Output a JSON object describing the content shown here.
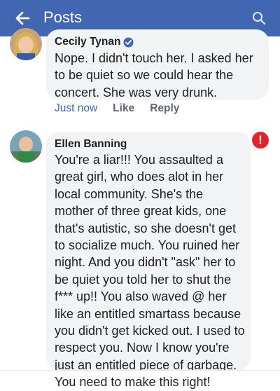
{
  "header": {
    "title": "Posts",
    "back_icon": "arrow-left-icon",
    "search_icon": "search-icon",
    "bg_color": "#4267b2"
  },
  "comments": [
    {
      "author": "Cecily Tynan",
      "verified_icon": "verified-badge-icon",
      "text": "Nope. I didn't touch her. I asked her to be quiet so we could hear the concert. She was very drunk.",
      "actions": {
        "time": "Just now",
        "like": "Like",
        "reply": "Reply"
      }
    },
    {
      "author": "Ellen Banning",
      "alert_icon": "error-exclamation-icon",
      "text": "You're a liar!!!  You assaulted a great girl, who does alot in her local community. She's the mother of three great kids, one that's autistic, so she doesn't get to socialize much. You ruined her night. And you didn't \"ask\" her to be quiet you told her to shut the f*** up!!  You also waved @ her like an entitled smartass because you didn't get kicked out.  I used to respect you. Now I know you're just an entitled piece of garbage. You need to make this right!"
    }
  ],
  "colors": {
    "bubble": "#f2f3f5",
    "link_blue": "#4267b2",
    "alert_red": "#e0242b"
  }
}
